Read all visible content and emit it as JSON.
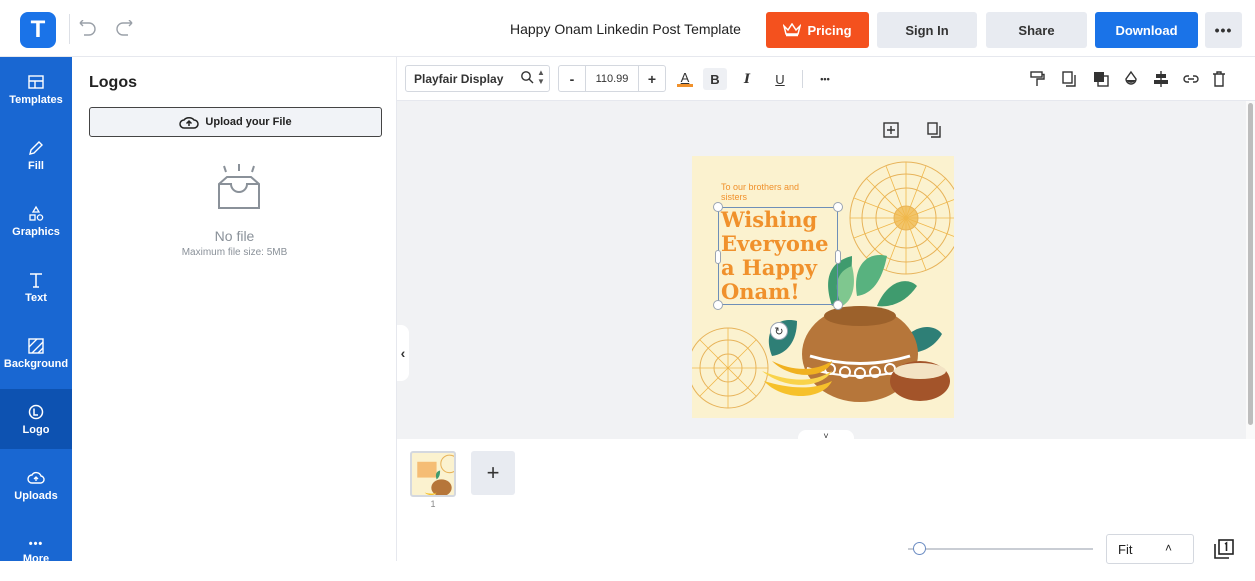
{
  "header": {
    "logo_letter": "T",
    "doc_title": "Happy Onam Linkedin Post Template",
    "pricing_label": "Pricing",
    "signin_label": "Sign In",
    "share_label": "Share",
    "download_label": "Download",
    "more_label": "•••"
  },
  "sidebar": {
    "items": [
      {
        "label": "Templates",
        "icon": "templates-icon"
      },
      {
        "label": "Fill",
        "icon": "pencil-icon"
      },
      {
        "label": "Graphics",
        "icon": "shapes-icon"
      },
      {
        "label": "Text",
        "icon": "text-icon"
      },
      {
        "label": "Background",
        "icon": "background-icon"
      },
      {
        "label": "Logo",
        "icon": "logo-icon",
        "active": true
      },
      {
        "label": "Uploads",
        "icon": "upload-cloud-icon"
      },
      {
        "label": "More",
        "icon": "more-icon"
      }
    ],
    "more_dots": "•••"
  },
  "panel": {
    "title": "Logos",
    "upload_label": "Upload your File",
    "empty_title": "No file",
    "empty_subtitle": "Maximum file size: 5MB"
  },
  "toolbar": {
    "font_family": "Playfair Display",
    "font_size": "110.99",
    "minus": "-",
    "plus": "+",
    "color_letter": "A",
    "bold": "B",
    "italic": "I",
    "underline": "U",
    "more": "•••"
  },
  "canvas": {
    "design_small_text": "To our brothers and sisters",
    "design_heading": "Wishing Everyone a Happy Onam!",
    "collapse_arrow": "‹",
    "expand_arrow": "˅"
  },
  "pages": {
    "thumb_number": "1",
    "add_label": "+"
  },
  "footer": {
    "zoom_value": "Fit",
    "zoom_chevron": "˄"
  },
  "colors": {
    "brand_blue": "#1a73e8",
    "sidebar_blue": "#1967d2",
    "pricing_orange": "#f4511e",
    "design_bg": "#fbf2cf",
    "design_text": "#f0912c"
  }
}
